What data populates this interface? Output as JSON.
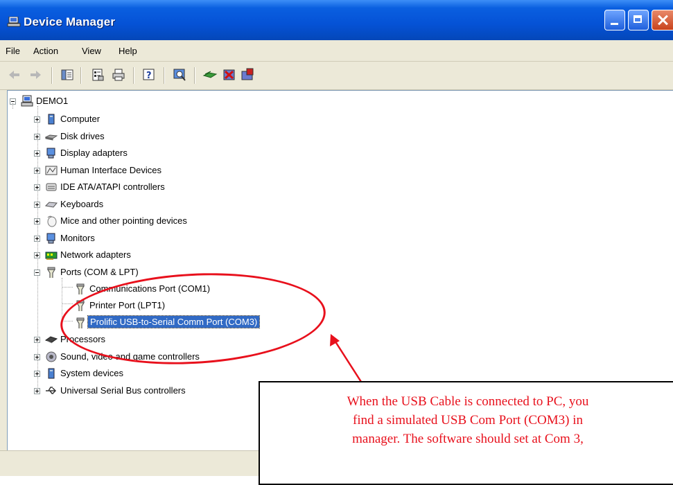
{
  "window": {
    "title": "Device Manager"
  },
  "menu": {
    "items": [
      "File",
      "Action",
      "View",
      "Help"
    ]
  },
  "toolbar": {
    "buttons": [
      "back",
      "forward",
      "show-hide-console-tree",
      "properties",
      "print",
      "help",
      "scan-for-hardware-changes",
      "update-driver",
      "uninstall",
      "disable"
    ]
  },
  "tree": {
    "root": "DEMO1",
    "categories": [
      {
        "label": "Computer",
        "icon": "computer-icon",
        "expanded": false
      },
      {
        "label": "Disk drives",
        "icon": "disk-drive-icon",
        "expanded": false
      },
      {
        "label": "Display adapters",
        "icon": "display-adapter-icon",
        "expanded": false
      },
      {
        "label": "Human Interface Devices",
        "icon": "hid-icon",
        "expanded": false
      },
      {
        "label": "IDE ATA/ATAPI controllers",
        "icon": "ide-controller-icon",
        "expanded": false
      },
      {
        "label": "Keyboards",
        "icon": "keyboard-icon",
        "expanded": false
      },
      {
        "label": "Mice and other pointing devices",
        "icon": "mouse-icon",
        "expanded": false
      },
      {
        "label": "Monitors",
        "icon": "monitor-icon",
        "expanded": false
      },
      {
        "label": "Network adapters",
        "icon": "network-adapter-icon",
        "expanded": false
      },
      {
        "label": "Ports (COM & LPT)",
        "icon": "port-icon",
        "expanded": true
      },
      {
        "label": "Processors",
        "icon": "processor-icon",
        "expanded": false
      },
      {
        "label": "Sound, video and game controllers",
        "icon": "sound-icon",
        "expanded": false
      },
      {
        "label": "System devices",
        "icon": "system-device-icon",
        "expanded": false
      },
      {
        "label": "Universal Serial Bus controllers",
        "icon": "usb-icon",
        "expanded": false
      }
    ],
    "ports_children": [
      {
        "label": "Communications Port (COM1)",
        "selected": false
      },
      {
        "label": "Printer Port (LPT1)",
        "selected": false
      },
      {
        "label": "Prolific USB-to-Serial Comm Port (COM3)",
        "selected": true
      }
    ]
  },
  "annotation": {
    "color": "#e8101c",
    "lines": [
      "When the USB Cable is connected to PC, you",
      "find a simulated USB Com Port (COM3) in",
      "manager. The software should set at Com 3,"
    ]
  },
  "colors": {
    "titlebar": "#0552d6",
    "selection": "#316ac5",
    "chrome": "#ece9d8"
  }
}
